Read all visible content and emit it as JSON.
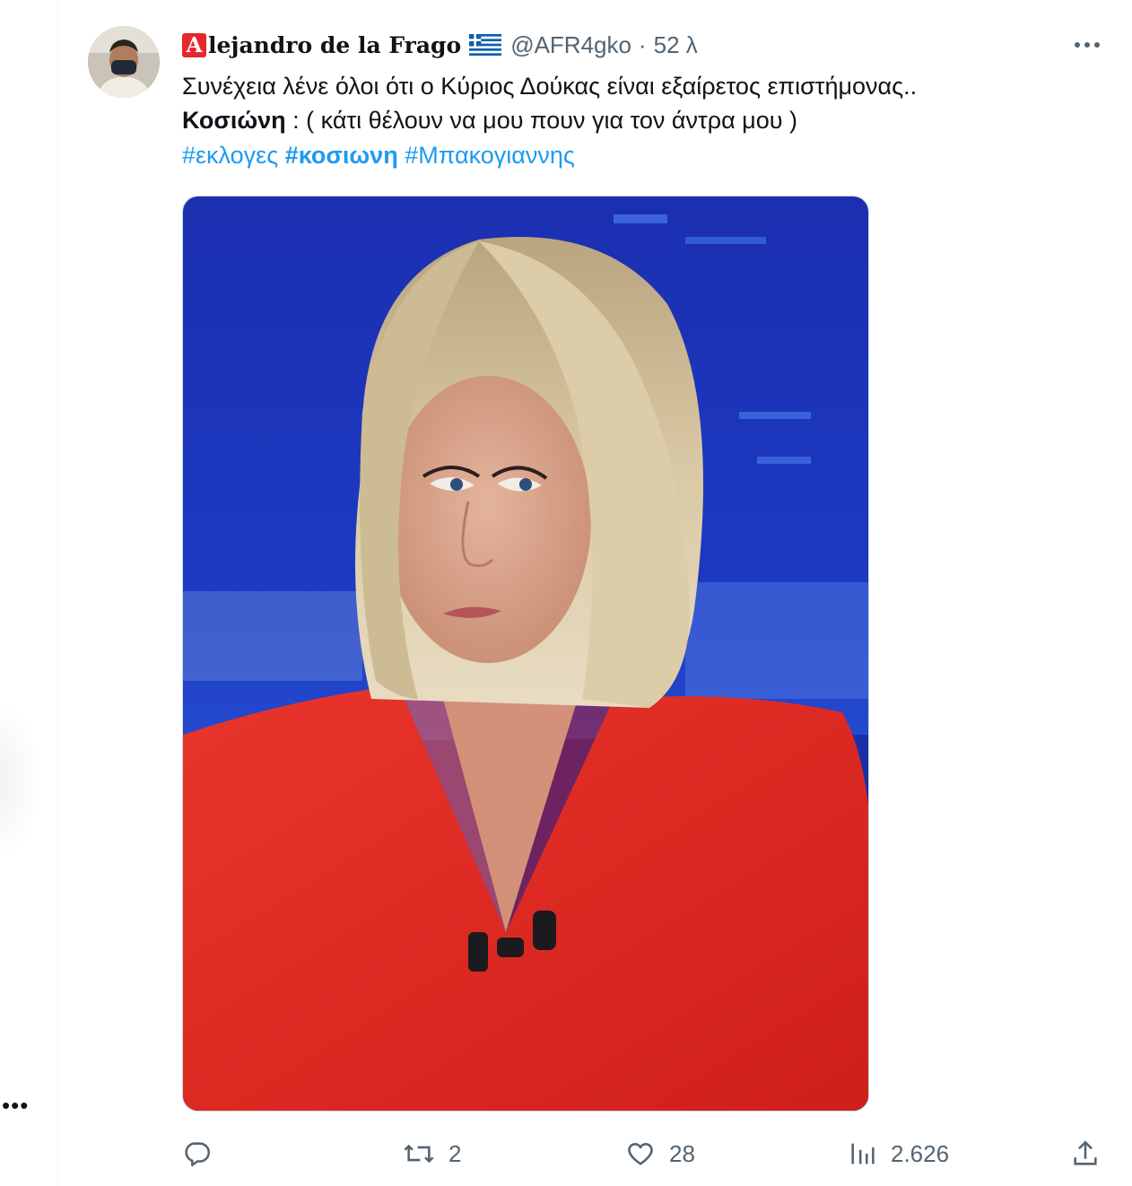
{
  "sidebar": {
    "more_label": "•••"
  },
  "tweet": {
    "author": {
      "badge_letter": "A",
      "display_name": "lejandro de la Frago",
      "handle": "@AFR4gko",
      "separator": "·",
      "time": "52 λ",
      "avatar_icon": "user-avatar"
    },
    "text": {
      "line1": "Συνέχεια λένε όλοι ότι ο Κύριος Δούκας είναι εξαίρετος επιστήμονας..",
      "line2_bold": "Κοσιώνη",
      "line2_rest": " : ( κάτι θέλουν να μου πουν για τον άντρα μου )",
      "hashtags": [
        "#εκλογες",
        "#κοσιωνη",
        "#Μπακογιαννης"
      ]
    },
    "actions": {
      "reply": {
        "icon": "reply-icon",
        "count": ""
      },
      "retweet": {
        "icon": "retweet-icon",
        "count": "2"
      },
      "like": {
        "icon": "heart-icon",
        "count": "28"
      },
      "views": {
        "icon": "views-icon",
        "count": "2.626"
      },
      "share": {
        "icon": "share-icon",
        "count": ""
      }
    }
  },
  "colors": {
    "link": "#1d9bf0",
    "muted": "#536471",
    "text": "#0f1419",
    "badge": "#e8262c"
  }
}
